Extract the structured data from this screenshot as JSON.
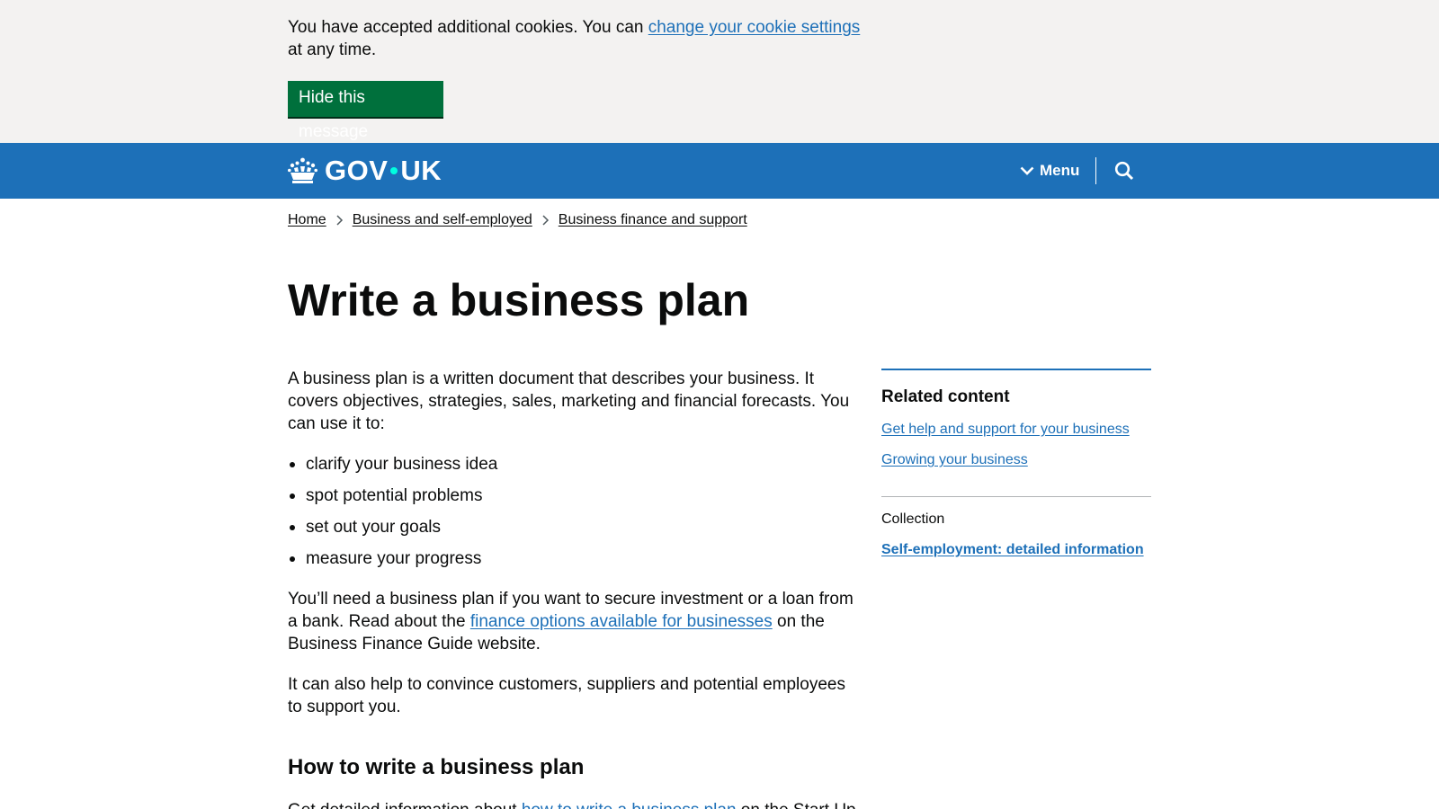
{
  "cookie_banner": {
    "text_before": "You have accepted additional cookies. You can ",
    "link_text": "change your cookie settings",
    "text_after": " at any time.",
    "hide_button": "Hide this message"
  },
  "header": {
    "logo_left": "GOV",
    "logo_right": "UK",
    "menu_label": "Menu",
    "icons": [
      "crown-icon",
      "chevron-down-icon",
      "search-icon"
    ]
  },
  "breadcrumbs": [
    "Home",
    "Business and self-employed",
    "Business finance and support"
  ],
  "main": {
    "title": "Write a business plan",
    "intro": "A business plan is a written document that describes your business. It covers objectives, strategies, sales, marketing and financial forecasts. You can use it to:",
    "list": [
      "clarify your business idea",
      "spot potential problems",
      "set out your goals",
      "measure your progress"
    ],
    "para2_before": "You’ll need a business plan if you want to secure investment or a loan from a bank. Read about the ",
    "para2_link": "finance options available for businesses",
    "para2_after": " on the Business Finance Guide website.",
    "para3": "It can also help to convince customers, suppliers and potential employees to support you.",
    "heading2": "How to write a business plan",
    "para4_before": "Get detailed information about ",
    "para4_link": "how to write a business plan",
    "para4_after": " on the Start Up"
  },
  "sidebar": {
    "related_title": "Related content",
    "related_links": [
      "Get help and support for your business",
      "Growing your business"
    ],
    "collection_label": "Collection",
    "collection_link": "Self-employment: detailed information"
  },
  "colors": {
    "header_blue": "#1d70b8",
    "button_green": "#00703c",
    "banner_grey": "#f3f2f1",
    "link_blue": "#1d70b8",
    "logo_dot": "#00ffe0"
  }
}
